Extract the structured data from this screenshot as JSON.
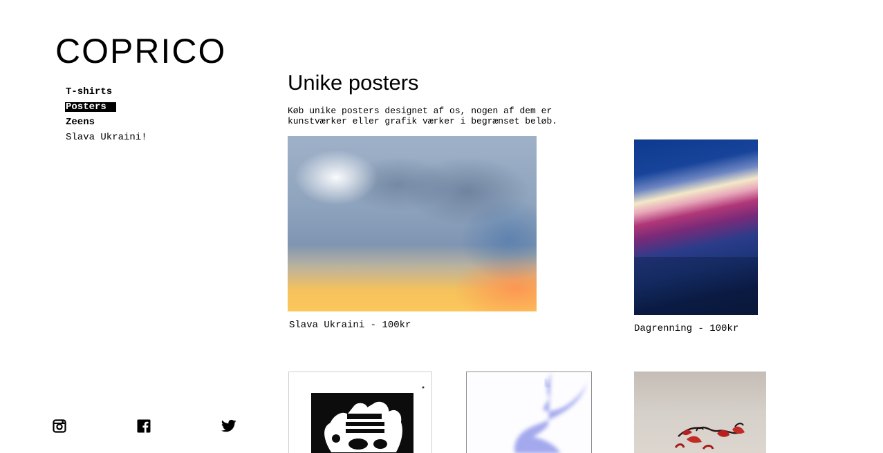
{
  "brand": {
    "name": "COPRICO"
  },
  "nav": {
    "items": [
      {
        "label": "T-shirts",
        "active": false,
        "bold": true
      },
      {
        "label": "Posters",
        "active": true,
        "bold": true
      },
      {
        "label": "Zeens",
        "active": false,
        "bold": true
      },
      {
        "label": "Slava Ukraini!",
        "active": false,
        "bold": false
      }
    ]
  },
  "main": {
    "title": "Unike posters",
    "intro_line1": "Køb unike posters designet af os, nogen af dem er",
    "intro_line2": "kunstværker eller grafik værker i begrænset beløb.",
    "posters": [
      {
        "caption": "Slava Ukraini - 100kr"
      },
      {
        "caption": "Dagrenning - 100kr"
      },
      {
        "caption": ""
      },
      {
        "caption": ""
      },
      {
        "caption": ""
      }
    ]
  },
  "socials": [
    "instagram-icon",
    "facebook-icon",
    "twitter-icon"
  ]
}
